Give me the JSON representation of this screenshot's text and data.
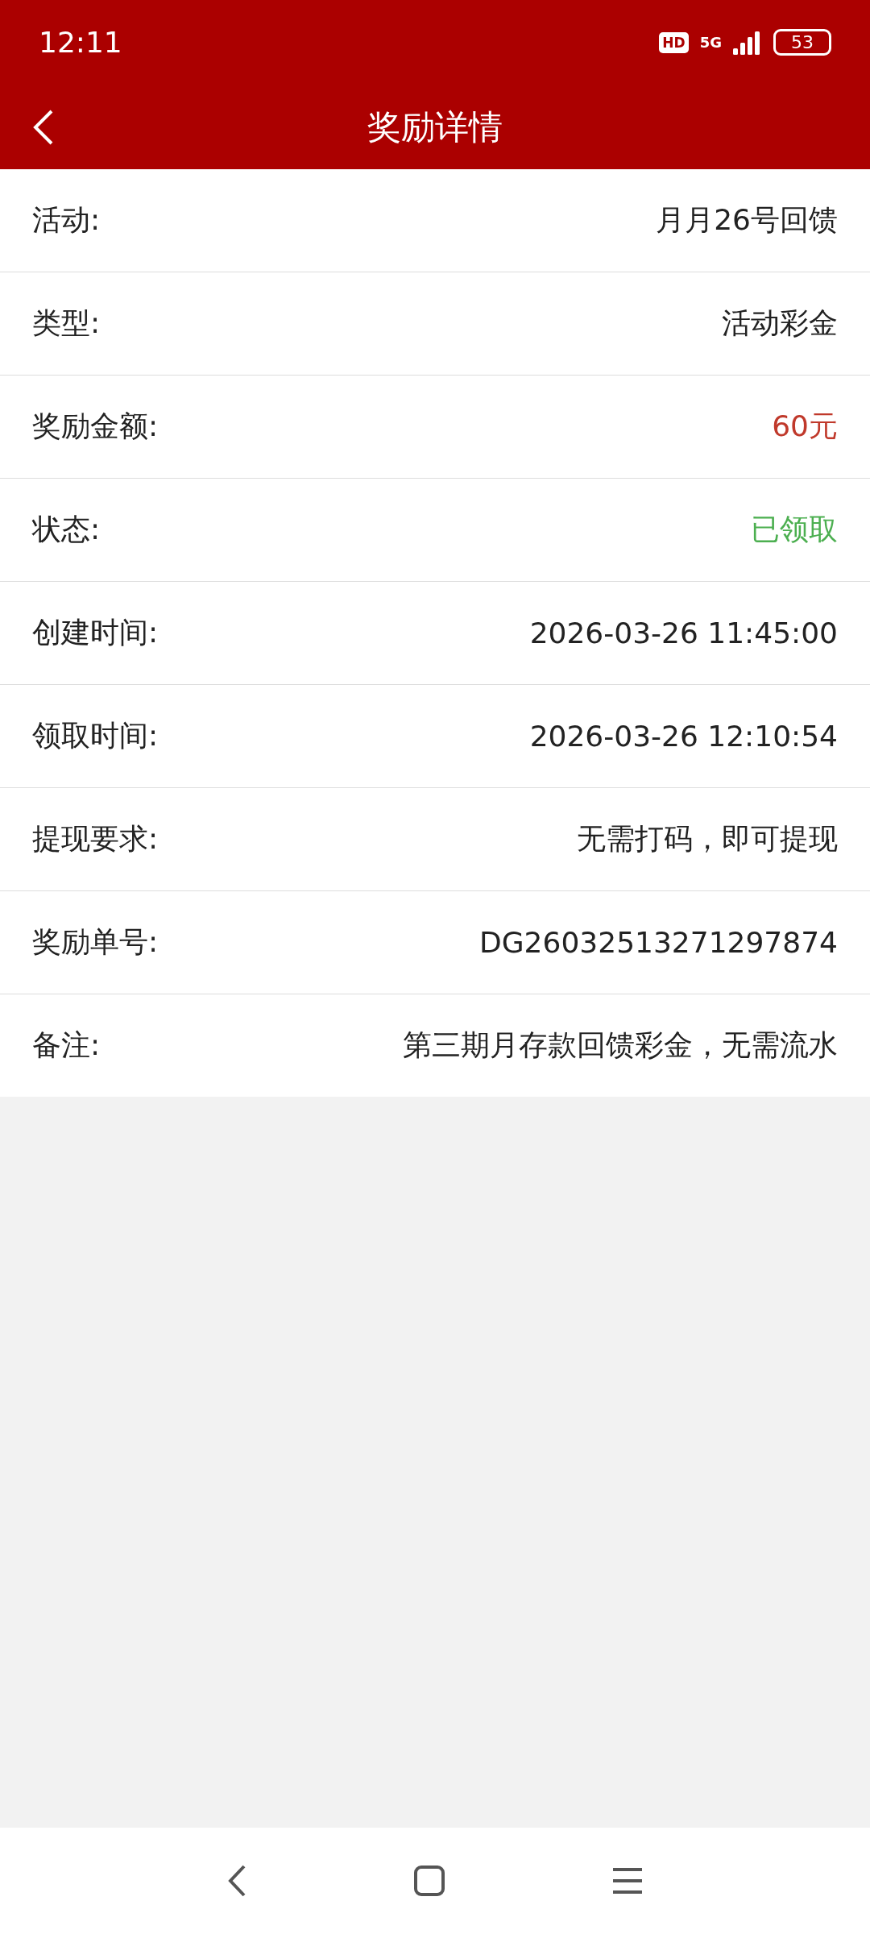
{
  "status_bar": {
    "time": "12:11",
    "hd": "HD",
    "network": "5G",
    "battery": "53"
  },
  "header": {
    "title": "奖励详情"
  },
  "details": [
    {
      "label": "活动:",
      "value": "月月26号回馈",
      "kind": "plain"
    },
    {
      "label": "类型:",
      "value": "活动彩金",
      "kind": "plain"
    },
    {
      "label": "奖励金额:",
      "value": "60元",
      "kind": "amount"
    },
    {
      "label": "状态:",
      "value": "已领取",
      "kind": "status"
    },
    {
      "label": "创建时间:",
      "value": "2026-03-26 11:45:00",
      "kind": "plain"
    },
    {
      "label": "领取时间:",
      "value": "2026-03-26 12:10:54",
      "kind": "plain"
    },
    {
      "label": "提现要求:",
      "value": "无需打码，即可提现",
      "kind": "plain"
    },
    {
      "label": "奖励单号:",
      "value": "DG26032513271297874",
      "kind": "plain"
    },
    {
      "label": "备注:",
      "value": "第三期月存款回馈彩金，无需流水",
      "kind": "plain"
    }
  ]
}
